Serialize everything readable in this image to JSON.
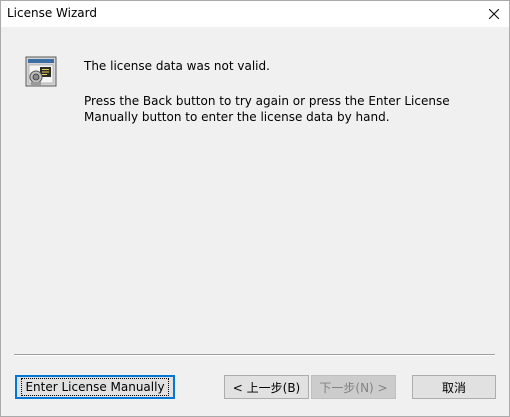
{
  "window": {
    "title": "License Wizard"
  },
  "message": {
    "line1": "The license data was not valid.",
    "line2": "Press the Back button to try again or press the Enter License",
    "line3": "Manually button to enter the license data by hand."
  },
  "buttons": {
    "enter_manual": "Enter License Manually",
    "back": "< 上一步(B)",
    "next": "下一步(N) >",
    "cancel": "取消"
  },
  "icons": {
    "app": "license-certificate-icon",
    "close": "close-icon"
  }
}
